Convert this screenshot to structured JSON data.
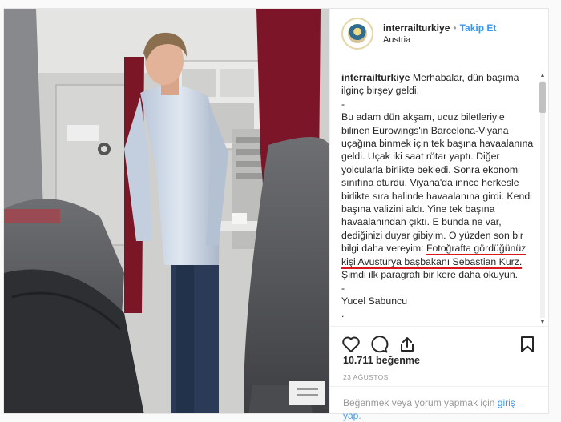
{
  "post": {
    "username": "interrailturkiye",
    "separator": "•",
    "follow_label": "Takip Et",
    "location": "Austria",
    "caption": {
      "intro": "Merhabalar, dün başıma ilginç birşey geldi.",
      "dash1": "-",
      "body_part1": "Bu adam dün akşam, ucuz biletleriyle bilinen Eurowings'in Barcelona-Viyana uçağına binmek için tek başına havaalanına geldi. Uçak iki saat rötar yaptı. Diğer yolcularla birlikte bekledi. Sonra ekonomi sınıfına oturdu. Viyana'da innce herkesle birlikte sıra halinde havaalanına girdi. Kendi başına valizini aldı. Yine tek başına havaalanından çıktı. E bunda ne var, dediğinizi duyar gibiyim. O yüzden son bir bilgi daha vereyim: ",
      "highlight1": "Fotoğrafta gördüğünüz",
      "highlight2": "kişi Avusturya başbakanı Sebastian Kurz.",
      "body_part2": "Şimdi ilk paragrafı bir kere daha okuyun.",
      "dash2": "-",
      "signature": "Yucel Sabuncu",
      "dot1": ".",
      "dot2": "."
    },
    "likes": "10.711 beğenme",
    "date": "23 AĞUSTOS",
    "login_prompt": "Beğenmek veya yorum yapmak için",
    "login_link": "giriş yap",
    "login_end": "."
  },
  "icons": {
    "like": "heart-icon",
    "comment": "comment-icon",
    "share": "share-icon",
    "save": "bookmark-icon"
  },
  "colors": {
    "link": "#3897f0",
    "underline": "#d9171e"
  }
}
